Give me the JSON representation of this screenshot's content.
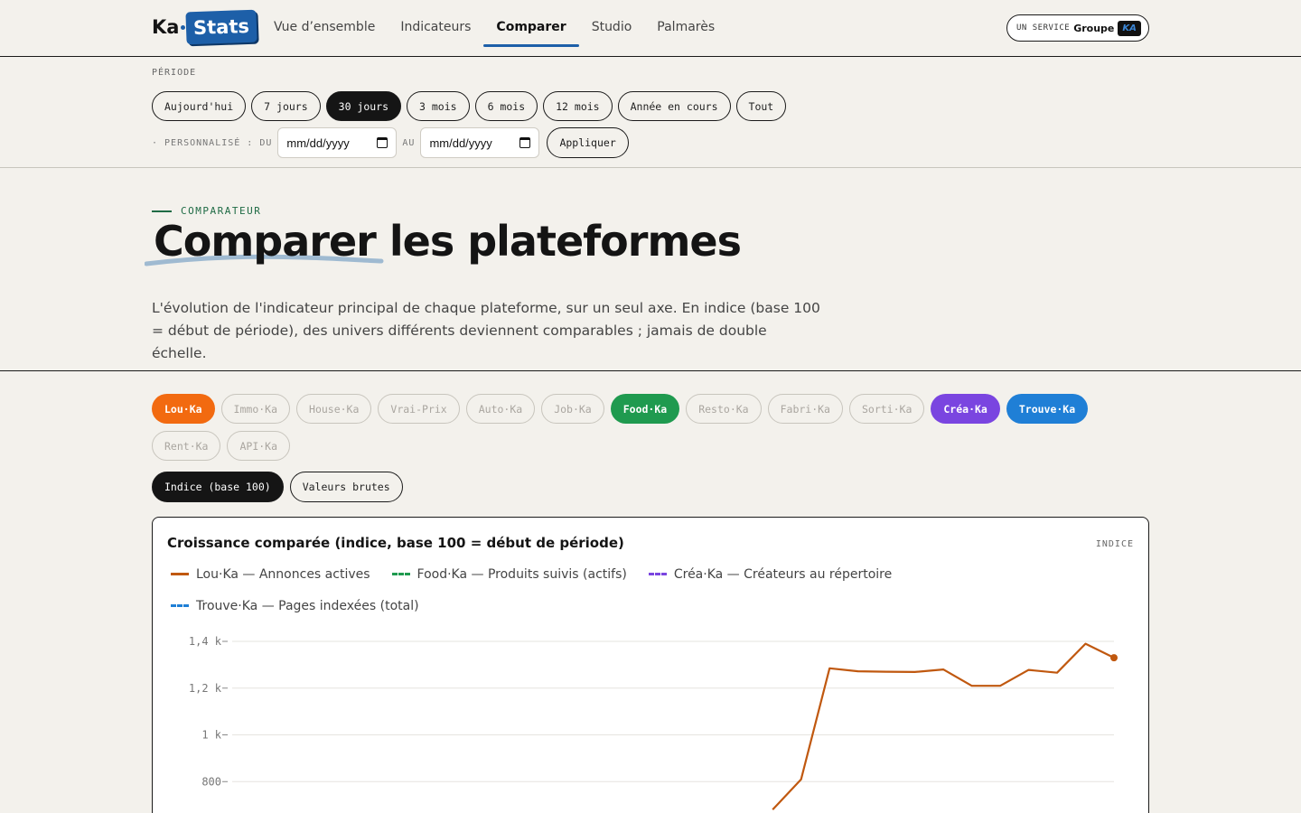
{
  "brand": {
    "ka": "Ka",
    "stats": "Stats"
  },
  "nav": [
    {
      "label": "Vue d’ensemble",
      "active": false
    },
    {
      "label": "Indicateurs",
      "active": false
    },
    {
      "label": "Comparer",
      "active": true
    },
    {
      "label": "Studio",
      "active": false
    },
    {
      "label": "Palmarès",
      "active": false
    }
  ],
  "service": {
    "label": "UN SERVICE",
    "group": "Groupe",
    "badge": "KA"
  },
  "period": {
    "label": "PÉRIODE",
    "options": [
      "Aujourd'hui",
      "7 jours",
      "30 jours",
      "3 mois",
      "6 mois",
      "12 mois",
      "Année en cours",
      "Tout"
    ],
    "selected": "30 jours",
    "custom_label": "· PERSONNALISÉ : DU",
    "to_label": "AU",
    "from_value": "mm/dd/yyyy",
    "to_value": "mm/dd/yyyy",
    "apply": "Appliquer"
  },
  "hero": {
    "eyebrow": "COMPARATEUR",
    "title_1": "Comparer",
    "title_2": " les plateformes",
    "lead": "L'évolution de l'indicateur principal de chaque plateforme, sur un seul axe. En indice (base 100 = début de période), des univers différents deviennent comparables ; jamais de double échelle."
  },
  "platforms": [
    {
      "label": "Lou·Ka",
      "on": true,
      "color": "#f26a10"
    },
    {
      "label": "Immo·Ka",
      "on": false
    },
    {
      "label": "House·Ka",
      "on": false
    },
    {
      "label": "Vrai-Prix",
      "on": false
    },
    {
      "label": "Auto·Ka",
      "on": false
    },
    {
      "label": "Job·Ka",
      "on": false
    },
    {
      "label": "Food·Ka",
      "on": true,
      "color": "#1f9a4f"
    },
    {
      "label": "Resto·Ka",
      "on": false
    },
    {
      "label": "Fabri·Ka",
      "on": false
    },
    {
      "label": "Sorti·Ka",
      "on": false
    },
    {
      "label": "Créa·Ka",
      "on": true,
      "color": "#7a45e0"
    },
    {
      "label": "Trouve·Ka",
      "on": true,
      "color": "#1f7fd6"
    },
    {
      "label": "Rent·Ka",
      "on": false
    },
    {
      "label": "API·Ka",
      "on": false
    }
  ],
  "modes": [
    {
      "label": "Indice (base 100)",
      "selected": true
    },
    {
      "label": "Valeurs brutes",
      "selected": false
    }
  ],
  "chart": {
    "title": "Croissance comparée (indice, base 100 = début de période)",
    "tag": "INDICE"
  },
  "chart_data": {
    "type": "line",
    "title": "Croissance comparée (indice, base 100 = début de période)",
    "ylim": [
      800,
      1400
    ],
    "y_ticks": [
      {
        "value": 1400,
        "label": "1,4 k"
      },
      {
        "value": 1200,
        "label": "1,2 k"
      },
      {
        "value": 1000,
        "label": "1 k"
      },
      {
        "value": 800,
        "label": "800"
      }
    ],
    "grid": true,
    "legend_position": "top-left",
    "series": [
      {
        "name": "Lou·Ka — Annonces actives",
        "color": "#c0580f",
        "dashed": false,
        "values": [
          null,
          null,
          null,
          null,
          null,
          null,
          null,
          null,
          null,
          null,
          null,
          null,
          null,
          null,
          null,
          null,
          null,
          null,
          null,
          680,
          810,
          1285,
          1272,
          1270,
          1269,
          1280,
          1210,
          1210,
          1278,
          1266,
          1390,
          1330
        ]
      },
      {
        "name": "Food·Ka — Produits suivis (actifs)",
        "color": "#1f9a4f",
        "dashed": true,
        "values": []
      },
      {
        "name": "Créa·Ka — Créateurs au répertoire",
        "color": "#7a45e0",
        "dashed": true,
        "values": []
      },
      {
        "name": "Trouve·Ka — Pages indexées (total)",
        "color": "#1f7fd6",
        "dashed": true,
        "values": []
      }
    ]
  }
}
